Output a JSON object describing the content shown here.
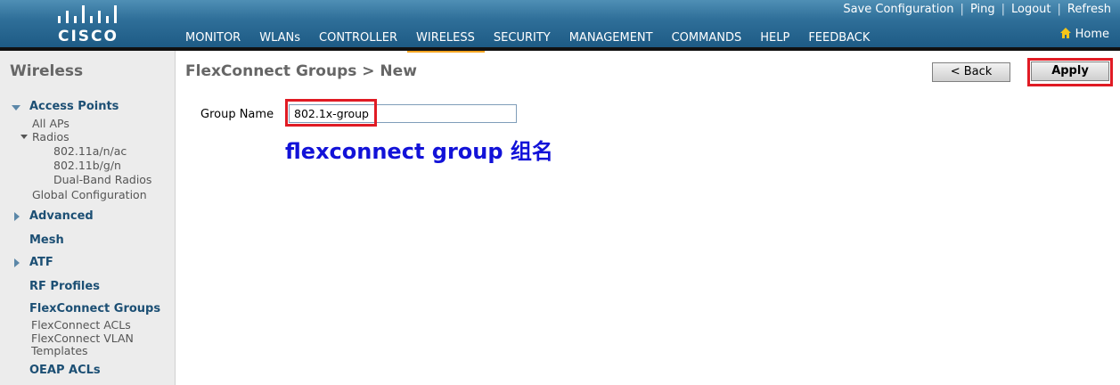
{
  "header": {
    "logo_text": "CISCO",
    "toplinks": [
      "Save Configuration",
      "Ping",
      "Logout",
      "Refresh"
    ],
    "nav": [
      "MONITOR",
      "WLANs",
      "CONTROLLER",
      "WIRELESS",
      "SECURITY",
      "MANAGEMENT",
      "COMMANDS",
      "HELP",
      "FEEDBACK"
    ],
    "active_nav": "WIRELESS",
    "home_label": "Home"
  },
  "sidebar": {
    "title": "Wireless",
    "access_points": "Access Points",
    "all_aps": "All APs",
    "radios": "Radios",
    "radio_80211a": "802.11a/n/ac",
    "radio_80211b": "802.11b/g/n",
    "radio_dual": "Dual-Band Radios",
    "global_config": "Global Configuration",
    "advanced": "Advanced",
    "mesh": "Mesh",
    "atf": "ATF",
    "rf_profiles": "RF Profiles",
    "flexconnect_groups": "FlexConnect Groups",
    "flexconnect_acls": "FlexConnect ACLs",
    "flexconnect_vlan_1": "FlexConnect VLAN",
    "flexconnect_vlan_2": "Templates",
    "oeap_acls": "OEAP ACLs"
  },
  "main": {
    "title": "FlexConnect Groups > New",
    "back_label": "< Back",
    "apply_label": "Apply",
    "group_name_label": "Group Name",
    "group_name_value": "802.1x-group",
    "annotation": "flexconnect group 组名"
  },
  "colors": {
    "header_blue": "#2f6f99",
    "nav_active_underline": "#f5a623",
    "highlight_red": "#e01b24",
    "annotation_blue": "#1212d8",
    "sidebar_link": "#1c4f74"
  }
}
